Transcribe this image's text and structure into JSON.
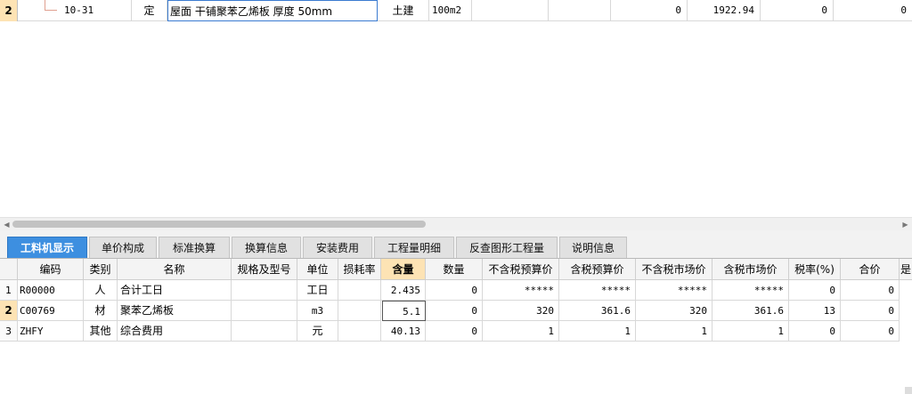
{
  "top_grid": {
    "rows": [
      {
        "row_number": "2",
        "code": "10-31",
        "type": "定",
        "name": "屋面 干铺聚苯乙烯板 厚度 50mm",
        "specialty": "土建",
        "unit": "100m2",
        "col_a": "",
        "col_b": "",
        "quantity": "0",
        "unit_price": "1922.94",
        "col_c": "0",
        "col_d": "0"
      }
    ]
  },
  "tabs": [
    {
      "label": "工料机显示",
      "active": true
    },
    {
      "label": "单价构成",
      "active": false
    },
    {
      "label": "标准换算",
      "active": false
    },
    {
      "label": "换算信息",
      "active": false
    },
    {
      "label": "安装费用",
      "active": false
    },
    {
      "label": "工程量明细",
      "active": false
    },
    {
      "label": "反查图形工程量",
      "active": false
    },
    {
      "label": "说明信息",
      "active": false
    }
  ],
  "bottom_grid": {
    "headers": [
      "编码",
      "类别",
      "名称",
      "规格及型号",
      "单位",
      "损耗率",
      "含量",
      "数量",
      "不含税预算价",
      "含税预算价",
      "不含税市场价",
      "含税市场价",
      "税率(%)",
      "合价",
      "是"
    ],
    "rows": [
      {
        "row_number": "1",
        "code": "R00000",
        "category": "人",
        "name": "合计工日",
        "spec": "",
        "unit": "工日",
        "loss_rate": "",
        "content": "2.435",
        "quantity": "0",
        "budget_price_excl_tax": "*****",
        "budget_price_incl_tax": "*****",
        "market_price_excl_tax": "*****",
        "market_price_incl_tax": "*****",
        "tax_rate": "0",
        "total": "0"
      },
      {
        "row_number": "2",
        "code": "C00769",
        "category": "材",
        "name": "聚苯乙烯板",
        "spec": "",
        "unit": "m3",
        "loss_rate": "",
        "content": "5.1",
        "quantity": "0",
        "budget_price_excl_tax": "320",
        "budget_price_incl_tax": "361.6",
        "market_price_excl_tax": "320",
        "market_price_incl_tax": "361.6",
        "tax_rate": "13",
        "total": "0"
      },
      {
        "row_number": "3",
        "code": "ZHFY",
        "category": "其他",
        "name": "综合费用",
        "spec": "",
        "unit": "元",
        "loss_rate": "",
        "content": "40.13",
        "quantity": "0",
        "budget_price_excl_tax": "1",
        "budget_price_incl_tax": "1",
        "market_price_excl_tax": "1",
        "market_price_incl_tax": "1",
        "tax_rate": "0",
        "total": "0"
      }
    ]
  },
  "colors": {
    "tab_active": "#3d8fe0",
    "selected_row_header": "#fde3b4",
    "edit_border": "#3b7bd1"
  }
}
